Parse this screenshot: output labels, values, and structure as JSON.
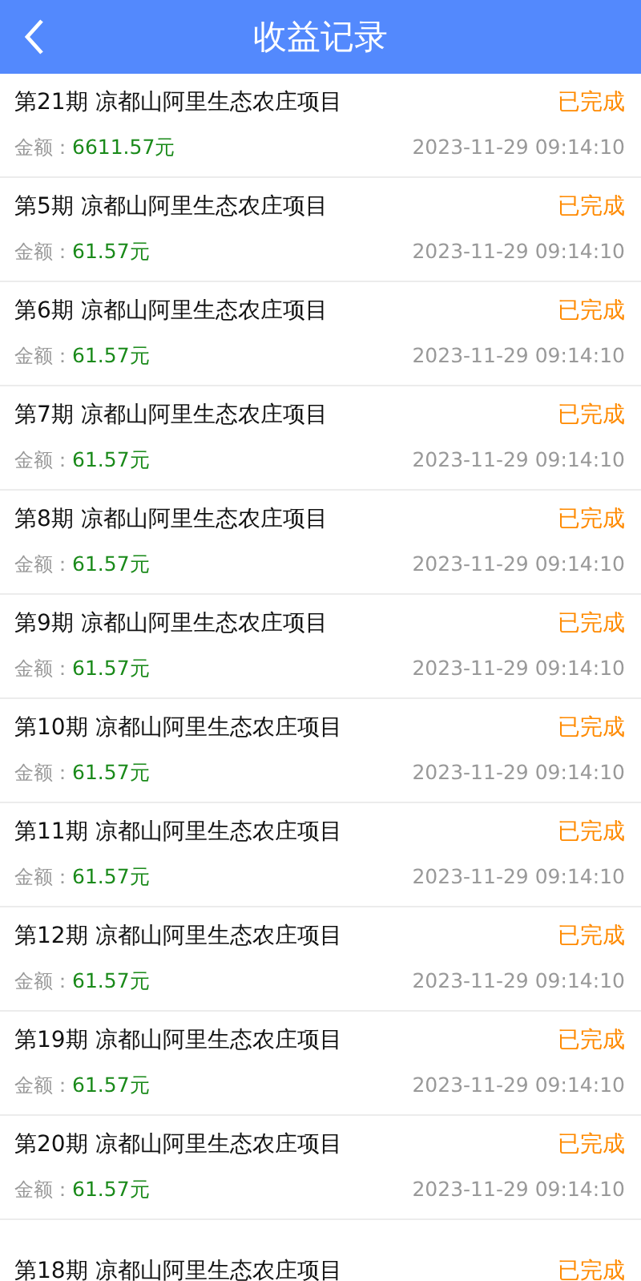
{
  "header": {
    "title": "收益记录"
  },
  "records": [
    {
      "title": "第21期 凉都山阿里生态农庄项目",
      "status": "已完成",
      "amount_label": "金额：",
      "amount": "6611.57元",
      "time": "2023-11-29 09:14:10"
    },
    {
      "title": "第5期 凉都山阿里生态农庄项目",
      "status": "已完成",
      "amount_label": "金额：",
      "amount": "61.57元",
      "time": "2023-11-29 09:14:10"
    },
    {
      "title": "第6期 凉都山阿里生态农庄项目",
      "status": "已完成",
      "amount_label": "金额：",
      "amount": "61.57元",
      "time": "2023-11-29 09:14:10"
    },
    {
      "title": "第7期 凉都山阿里生态农庄项目",
      "status": "已完成",
      "amount_label": "金额：",
      "amount": "61.57元",
      "time": "2023-11-29 09:14:10"
    },
    {
      "title": "第8期 凉都山阿里生态农庄项目",
      "status": "已完成",
      "amount_label": "金额：",
      "amount": "61.57元",
      "time": "2023-11-29 09:14:10"
    },
    {
      "title": "第9期 凉都山阿里生态农庄项目",
      "status": "已完成",
      "amount_label": "金额：",
      "amount": "61.57元",
      "time": "2023-11-29 09:14:10"
    },
    {
      "title": "第10期 凉都山阿里生态农庄项目",
      "status": "已完成",
      "amount_label": "金额：",
      "amount": "61.57元",
      "time": "2023-11-29 09:14:10"
    },
    {
      "title": "第11期 凉都山阿里生态农庄项目",
      "status": "已完成",
      "amount_label": "金额：",
      "amount": "61.57元",
      "time": "2023-11-29 09:14:10"
    },
    {
      "title": "第12期 凉都山阿里生态农庄项目",
      "status": "已完成",
      "amount_label": "金额：",
      "amount": "61.57元",
      "time": "2023-11-29 09:14:10"
    },
    {
      "title": "第19期 凉都山阿里生态农庄项目",
      "status": "已完成",
      "amount_label": "金额：",
      "amount": "61.57元",
      "time": "2023-11-29 09:14:10"
    },
    {
      "title": "第20期 凉都山阿里生态农庄项目",
      "status": "已完成",
      "amount_label": "金额：",
      "amount": "61.57元",
      "time": "2023-11-29 09:14:10"
    },
    {
      "title": "第18期 凉都山阿里生态农庄项目",
      "status": "已完成"
    }
  ]
}
